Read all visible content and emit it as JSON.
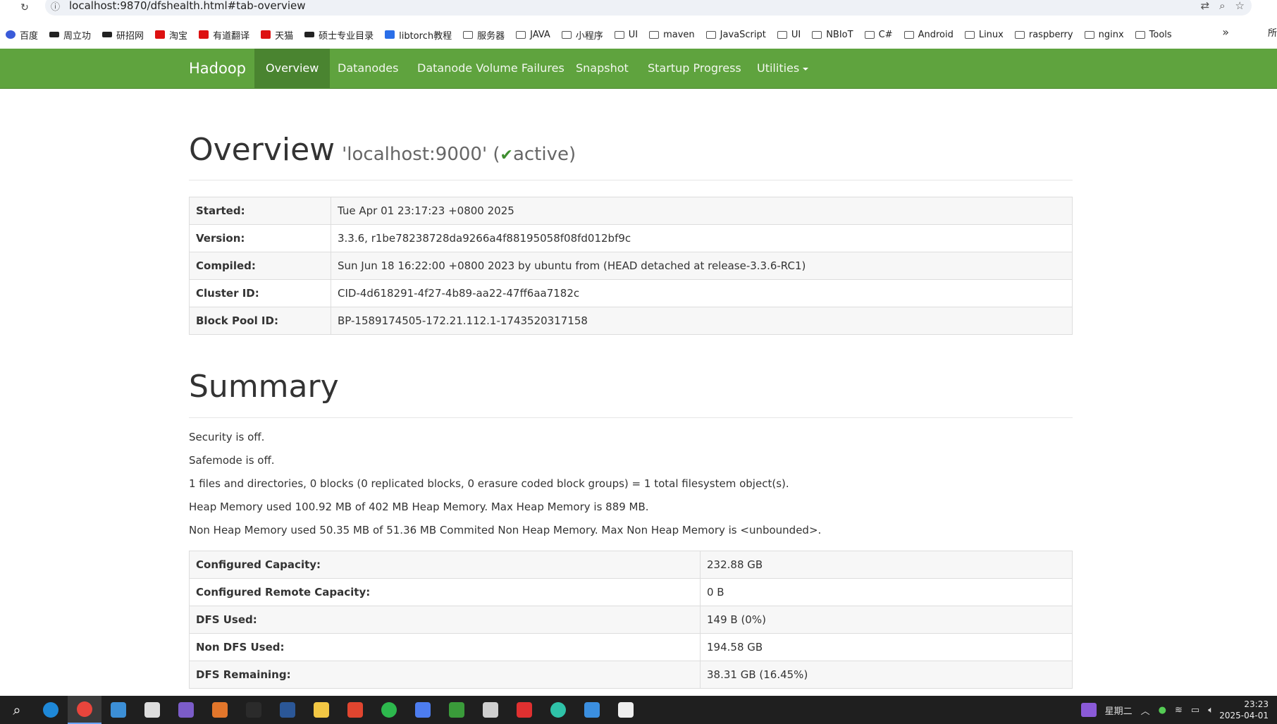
{
  "browser": {
    "url": "localhost:9870/dfshealth.html#tab-overview",
    "bookmarks": [
      {
        "label": "百度",
        "icon": "paw"
      },
      {
        "label": "周立功",
        "icon": "dark"
      },
      {
        "label": "研招网",
        "icon": "dark"
      },
      {
        "label": "淘宝",
        "icon": "red"
      },
      {
        "label": "有道翻译",
        "icon": "red"
      },
      {
        "label": "天猫",
        "icon": "red"
      },
      {
        "label": "硕士专业目录",
        "icon": "dark"
      },
      {
        "label": "libtorch教程",
        "icon": "blue"
      },
      {
        "label": "服务器",
        "icon": "folder"
      },
      {
        "label": "JAVA",
        "icon": "folder"
      },
      {
        "label": "小程序",
        "icon": "folder"
      },
      {
        "label": "UI",
        "icon": "folder"
      },
      {
        "label": "maven",
        "icon": "folder"
      },
      {
        "label": "JavaScript",
        "icon": "folder"
      },
      {
        "label": "UI",
        "icon": "folder"
      },
      {
        "label": "NBIoT",
        "icon": "folder"
      },
      {
        "label": "C#",
        "icon": "folder"
      },
      {
        "label": "Android",
        "icon": "folder"
      },
      {
        "label": "Linux",
        "icon": "folder"
      },
      {
        "label": "raspberry",
        "icon": "folder"
      },
      {
        "label": "nginx",
        "icon": "folder"
      },
      {
        "label": "Tools",
        "icon": "folder"
      }
    ],
    "bookmarks_more": "»",
    "bookmarks_cut": "所"
  },
  "navbar": {
    "brand": "Hadoop",
    "items": [
      "Overview",
      "Datanodes",
      "Datanode Volume Failures",
      "Snapshot",
      "Startup Progress",
      "Utilities"
    ]
  },
  "overview": {
    "title": "Overview",
    "host": "'localhost:9000' (",
    "check": "✔",
    "status": "active)",
    "rows": [
      {
        "label": "Started:",
        "value": "Tue Apr 01 23:17:23 +0800 2025"
      },
      {
        "label": "Version:",
        "value": "3.3.6, r1be78238728da9266a4f88195058f08fd012bf9c"
      },
      {
        "label": "Compiled:",
        "value": "Sun Jun 18 16:22:00 +0800 2023 by ubuntu from (HEAD detached at release-3.3.6-RC1)"
      },
      {
        "label": "Cluster ID:",
        "value": "CID-4d618291-4f27-4b89-aa22-47ff6aa7182c"
      },
      {
        "label": "Block Pool ID:",
        "value": "BP-1589174505-172.21.112.1-1743520317158"
      }
    ]
  },
  "summary": {
    "title": "Summary",
    "lines": [
      "Security is off.",
      "Safemode is off.",
      "1 files and directories, 0 blocks (0 replicated blocks, 0 erasure coded block groups) = 1 total filesystem object(s).",
      "Heap Memory used 100.92 MB of 402 MB Heap Memory. Max Heap Memory is 889 MB.",
      "Non Heap Memory used 50.35 MB of 51.36 MB Commited Non Heap Memory. Max Non Heap Memory is <unbounded>."
    ],
    "rows": [
      {
        "label": "Configured Capacity:",
        "value": "232.88 GB"
      },
      {
        "label": "Configured Remote Capacity:",
        "value": "0 B"
      },
      {
        "label": "DFS Used:",
        "value": "149 B (0%)"
      },
      {
        "label": "Non DFS Used:",
        "value": "194.58 GB"
      },
      {
        "label": "DFS Remaining:",
        "value": "38.31 GB (16.45%)"
      }
    ]
  },
  "taskbar": {
    "apps": [
      {
        "name": "search",
        "color": "#1f1f1f"
      },
      {
        "name": "edge",
        "color": "#1e88d8"
      },
      {
        "name": "chrome",
        "color": "#e8453c"
      },
      {
        "name": "remote-desktop",
        "color": "#3c8fd6"
      },
      {
        "name": "sniping",
        "color": "#dddddd"
      },
      {
        "name": "vs",
        "color": "#7b5cc8"
      },
      {
        "name": "devtool",
        "color": "#e2762b"
      },
      {
        "name": "terminal",
        "color": "#2b2b2b"
      },
      {
        "name": "powershell",
        "color": "#2b5797"
      },
      {
        "name": "explorer",
        "color": "#f2c744"
      },
      {
        "name": "app-red",
        "color": "#e0452f"
      },
      {
        "name": "wechat",
        "color": "#2db84d"
      },
      {
        "name": "notes",
        "color": "#4d7df0"
      },
      {
        "name": "editor",
        "color": "#3a9b3a"
      },
      {
        "name": "camera",
        "color": "#cfcfcf"
      },
      {
        "name": "wps",
        "color": "#e03030"
      },
      {
        "name": "boss",
        "color": "#2fc2a8"
      },
      {
        "name": "files",
        "color": "#3b8fe0"
      },
      {
        "name": "settings",
        "color": "#eeeeee"
      }
    ],
    "weekday": "星期二",
    "time": "23:23",
    "date": "2025-04-01"
  }
}
